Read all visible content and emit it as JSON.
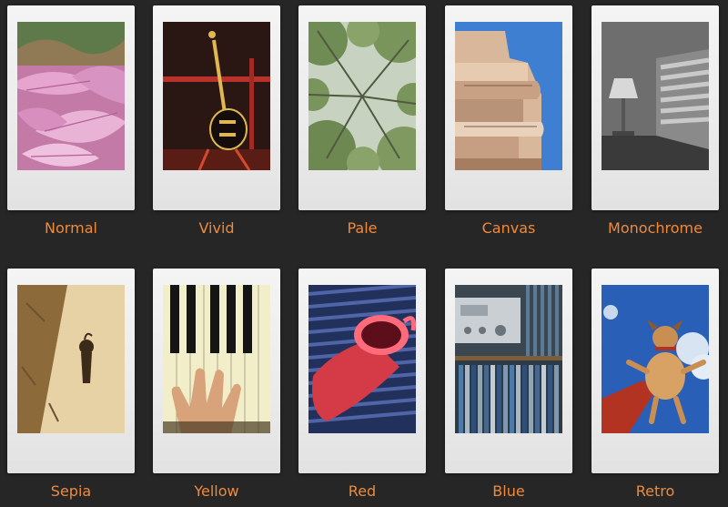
{
  "label_color": "#ee8a3c",
  "background_color": "#262626",
  "filters": [
    {
      "label": "Normal",
      "image": "pink-leaves-photo"
    },
    {
      "label": "Vivid",
      "image": "guitar-photo"
    },
    {
      "label": "Pale",
      "image": "tree-canopy-photo"
    },
    {
      "label": "Canvas",
      "image": "building-balconies-photo"
    },
    {
      "label": "Monochrome",
      "image": "lamp-window-photo"
    },
    {
      "label": "Sepia",
      "image": "sepia-shadow-photo"
    },
    {
      "label": "Yellow",
      "image": "piano-hand-photo"
    },
    {
      "label": "Red",
      "image": "coffee-cup-photo"
    },
    {
      "label": "Blue",
      "image": "radio-records-photo"
    },
    {
      "label": "Retro",
      "image": "dog-jumping-photo"
    }
  ]
}
